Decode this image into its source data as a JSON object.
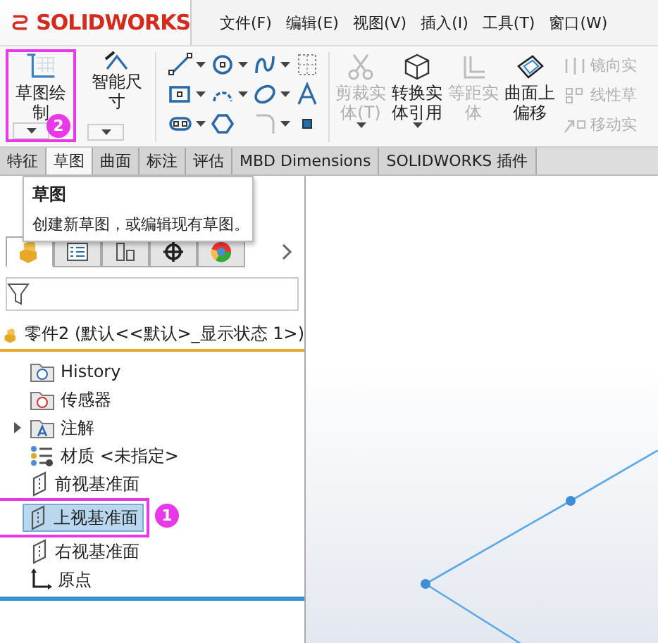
{
  "app": {
    "logo": "SOLIDWORKS"
  },
  "menu": [
    "文件(F)",
    "编辑(E)",
    "视图(V)",
    "插入(I)",
    "工具(T)",
    "窗口(W)"
  ],
  "toolbar": {
    "large_buttons": [
      {
        "label": "草图绘制",
        "highlighted": true,
        "badge": "2"
      },
      {
        "label": "智能尺寸",
        "highlighted": false
      }
    ],
    "buttons": [
      {
        "label": "剪裁实体(T)",
        "disabled": true,
        "dropdown": true
      },
      {
        "label": "转换实体引用",
        "disabled": false,
        "dropdown": true
      },
      {
        "label": "等距实体",
        "disabled": true,
        "dropdown": false
      },
      {
        "label": "曲面上偏移",
        "disabled": false,
        "dropdown": false
      }
    ],
    "side_buttons": [
      {
        "label": "镜向实",
        "disabled": true
      },
      {
        "label": "线性草",
        "disabled": true
      },
      {
        "label": "移动实",
        "disabled": true
      }
    ]
  },
  "tabs": [
    {
      "label": "特征",
      "selected": false
    },
    {
      "label": "草图",
      "selected": true
    },
    {
      "label": "曲面",
      "selected": false
    },
    {
      "label": "标注",
      "selected": false
    },
    {
      "label": "评估",
      "selected": false
    },
    {
      "label": "MBD Dimensions",
      "selected": false
    },
    {
      "label": "SOLIDWORKS 插件",
      "selected": false
    }
  ],
  "tooltip": {
    "title": "草图",
    "text": "创建新草图，或编辑现有草图。"
  },
  "feature_tree": {
    "header": "零件2  (默认<<默认>_显示状态 1>)",
    "items": [
      {
        "label": "History",
        "expandable": false,
        "selected": false
      },
      {
        "label": "传感器",
        "expandable": false,
        "selected": false
      },
      {
        "label": "注解",
        "expandable": true,
        "selected": false
      },
      {
        "label": "材质 <未指定>",
        "expandable": false,
        "selected": false
      },
      {
        "label": "前视基准面",
        "expandable": false,
        "selected": false
      },
      {
        "label": "上视基准面",
        "expandable": false,
        "selected": true,
        "highlighted": true,
        "badge": "1"
      },
      {
        "label": "右视基准面",
        "expandable": false,
        "selected": false
      },
      {
        "label": "原点",
        "expandable": false,
        "selected": false
      }
    ]
  }
}
